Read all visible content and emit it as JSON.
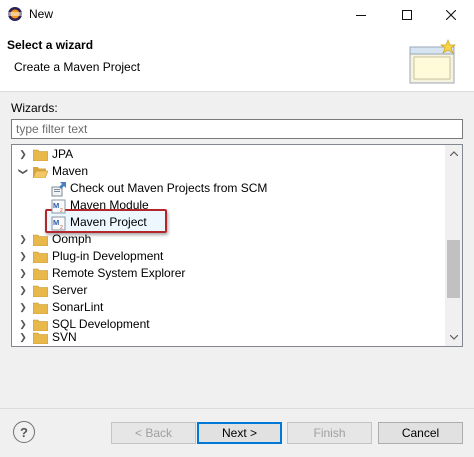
{
  "window": {
    "title": "New"
  },
  "banner": {
    "title": "Select a wizard",
    "description": "Create a Maven Project"
  },
  "wizards_label": "Wizards:",
  "filter": {
    "value": "",
    "placeholder": "type filter text"
  },
  "tree": {
    "rows": [
      {
        "label": "JPA",
        "type": "folder",
        "expanded": false
      },
      {
        "label": "Maven",
        "type": "folder",
        "expanded": true
      },
      {
        "label": "Check out Maven Projects from SCM",
        "type": "item",
        "icon": "checkout-icon"
      },
      {
        "label": "Maven Module",
        "type": "item",
        "icon": "maven-icon"
      },
      {
        "label": "Maven Project",
        "type": "item",
        "icon": "maven-icon",
        "selected": true
      },
      {
        "label": "Oomph",
        "type": "folder",
        "expanded": false
      },
      {
        "label": "Plug-in Development",
        "type": "folder",
        "expanded": false
      },
      {
        "label": "Remote System Explorer",
        "type": "folder",
        "expanded": false
      },
      {
        "label": "Server",
        "type": "folder",
        "expanded": false
      },
      {
        "label": "SonarLint",
        "type": "folder",
        "expanded": false
      },
      {
        "label": "SQL Development",
        "type": "folder",
        "expanded": false
      },
      {
        "label": "SVN",
        "type": "folder",
        "expanded": false
      }
    ]
  },
  "buttons": {
    "help": "?",
    "back": "< Back",
    "next": "Next >",
    "finish": "Finish",
    "cancel": "Cancel"
  },
  "colors": {
    "highlight_border": "#b3262c",
    "folder": "#e8b84a",
    "default_button_border": "#0078d7"
  }
}
